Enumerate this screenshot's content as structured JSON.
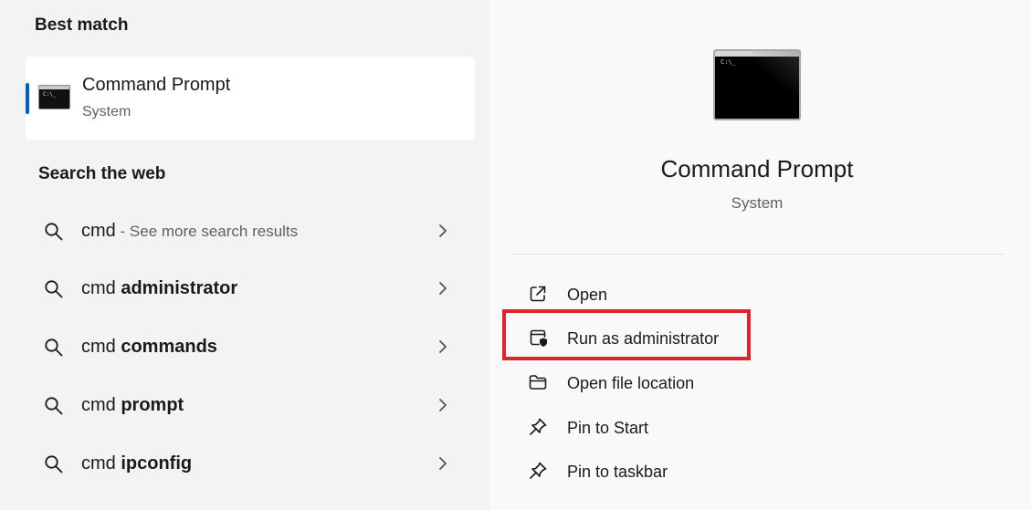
{
  "best_match": {
    "heading": "Best match",
    "app_name": "Command Prompt",
    "app_type": "System"
  },
  "search_web": {
    "heading": "Search the web",
    "items": [
      {
        "prefix": "cmd",
        "bold": "",
        "hint": " - See more search results"
      },
      {
        "prefix": "cmd ",
        "bold": "administrator",
        "hint": ""
      },
      {
        "prefix": "cmd ",
        "bold": "commands",
        "hint": ""
      },
      {
        "prefix": "cmd ",
        "bold": "prompt",
        "hint": ""
      },
      {
        "prefix": "cmd ",
        "bold": "ipconfig",
        "hint": ""
      }
    ]
  },
  "preview": {
    "title": "Command Prompt",
    "subtitle": "System",
    "actions": [
      {
        "label": "Open",
        "icon": "open-external-icon"
      },
      {
        "label": "Run as administrator",
        "icon": "shield-admin-icon"
      },
      {
        "label": "Open file location",
        "icon": "folder-icon"
      },
      {
        "label": "Pin to Start",
        "icon": "pin-icon"
      },
      {
        "label": "Pin to taskbar",
        "icon": "pin-icon"
      }
    ]
  },
  "colors": {
    "accent": "#005fb8",
    "highlight": "#e0232e",
    "left_bg": "#f3f3f3",
    "right_bg": "#f9f9f9"
  }
}
